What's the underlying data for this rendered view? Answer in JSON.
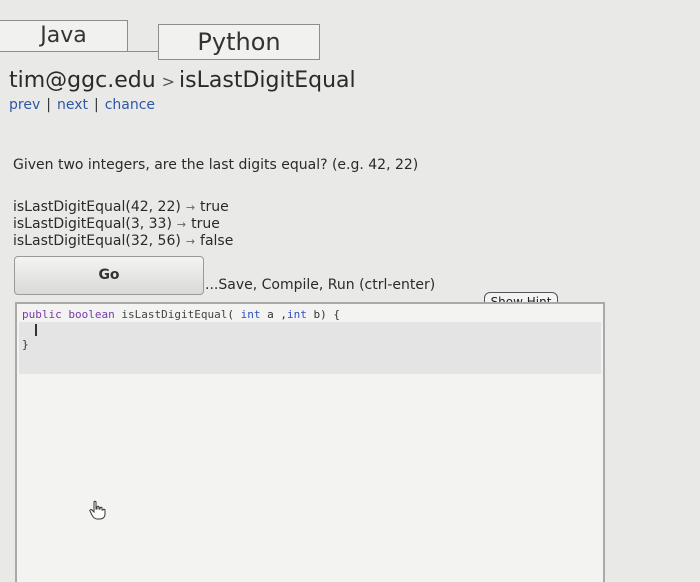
{
  "tabs": [
    {
      "label": "Java"
    },
    {
      "label": "Python"
    }
  ],
  "breadcrumb": {
    "user": "tim@ggc.edu",
    "separator": ">",
    "problem": "isLastDigitEqual"
  },
  "nav": {
    "prev": "prev",
    "next": "next",
    "chance": "chance",
    "pipe": "|"
  },
  "description": "Given two integers, are the last digits equal? (e.g. 42, 22)",
  "examples": [
    {
      "call": "isLastDigitEqual(42, 22)",
      "result": "true"
    },
    {
      "call": "isLastDigitEqual(3, 33)",
      "result": "true"
    },
    {
      "call": "isLastDigitEqual(32, 56)",
      "result": "false"
    }
  ],
  "arrow_glyph": "→",
  "go_button": {
    "label": "Go"
  },
  "run_hint": "...Save, Compile, Run (ctrl-enter)",
  "show_hint_button": {
    "label": "Show Hint"
  },
  "editor": {
    "kw1": "public",
    "kw2": "boolean",
    "fn_name": "isLastDigitEqual",
    "open_paren": "(",
    "type1": "int",
    "param1": "a",
    "comma": ",",
    "type2": "int",
    "param2": "b",
    "close": ") {",
    "closing_brace": "}"
  },
  "icons": {
    "pointer": "hand-pointer-icon"
  },
  "colors": {
    "link": "#2d57a8",
    "keyword": "#7a3aa8",
    "editor_bg": "#f3f3f2"
  }
}
